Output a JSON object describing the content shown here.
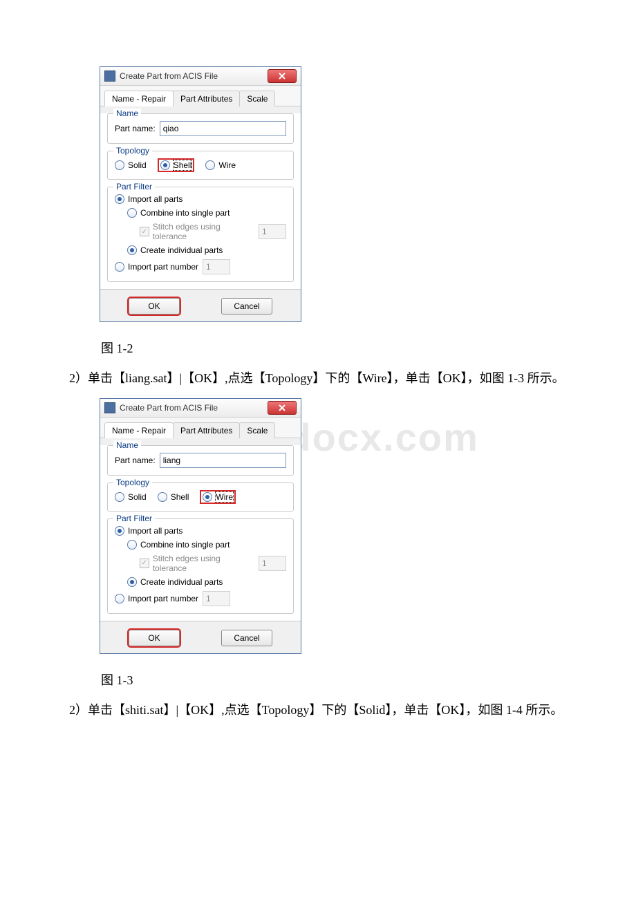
{
  "watermark": "www.bdocx.com",
  "dialog1": {
    "title": "Create Part from ACIS File",
    "tabs": {
      "t0": "Name - Repair",
      "t1": "Part Attributes",
      "t2": "Scale"
    },
    "name_group": "Name",
    "part_name_label": "Part name:",
    "part_name_value": "qiao",
    "topology_group": "Topology",
    "solid": "Solid",
    "shell": "Shell",
    "wire": "Wire",
    "filter_group": "Part Filter",
    "import_all": "Import all parts",
    "combine": "Combine into single part",
    "stitch": "Stitch edges using tolerance",
    "stitch_val": "1",
    "create_indiv": "Create individual parts",
    "import_num": "Import part number",
    "import_num_val": "1",
    "ok": "OK",
    "cancel": "Cancel"
  },
  "caption1": "图 1-2",
  "para1": "2）单击【liang.sat】|【OK】,点选【Topology】下的【Wire】，单击【OK】，如图 1-3 所示。",
  "dialog2": {
    "title": "Create Part from ACIS File",
    "tabs": {
      "t0": "Name - Repair",
      "t1": "Part Attributes",
      "t2": "Scale"
    },
    "name_group": "Name",
    "part_name_label": "Part name:",
    "part_name_value": "liang",
    "topology_group": "Topology",
    "solid": "Solid",
    "shell": "Shell",
    "wire": "Wire",
    "filter_group": "Part Filter",
    "import_all": "Import all parts",
    "combine": "Combine into single part",
    "stitch": "Stitch edges using tolerance",
    "stitch_val": "1",
    "create_indiv": "Create individual parts",
    "import_num": "Import part number",
    "import_num_val": "1",
    "ok": "OK",
    "cancel": "Cancel"
  },
  "caption2": "图 1-3",
  "para2": "2）单击【shiti.sat】|【OK】,点选【Topology】下的【Solid】，单击【OK】，如图 1-4 所示。"
}
